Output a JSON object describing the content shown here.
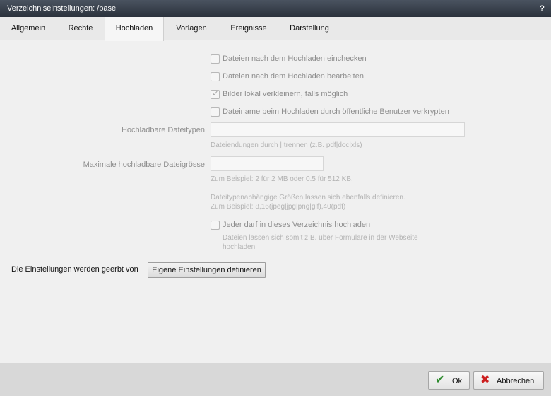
{
  "window": {
    "title": "Verzeichniseinstellungen: /base",
    "help": "?"
  },
  "tabs": [
    "Allgemein",
    "Rechte",
    "Hochladen",
    "Vorlagen",
    "Ereignisse",
    "Darstellung"
  ],
  "active_tab": "Hochladen",
  "options": {
    "checkin": {
      "label": "Dateien nach dem Hochladen einchecken",
      "checked": false
    },
    "edit": {
      "label": "Dateien nach dem Hochladen bearbeiten",
      "checked": false
    },
    "resize": {
      "label": "Bilder lokal verkleinern, falls möglich",
      "checked": true
    },
    "encrypt": {
      "label": "Dateiname beim Hochladen durch öffentliche Benutzer verkrypten",
      "checked": false
    }
  },
  "filetypes": {
    "label": "Hochladbare Dateitypen",
    "value": "",
    "hint": "Dateiendungen durch | trennen (z.B. pdf|doc|xls)"
  },
  "maxsize": {
    "label": "Maximale hochladbare Dateigrösse",
    "value": "",
    "hint1": "Zum Beispiel: 2 für 2 MB oder 0.5 für 512 KB.",
    "hint2": "Dateitypenabhängige Größen lassen sich ebenfalls definieren.",
    "hint3": "Zum Beispiel: 8,16(jpeg|jpg|png|gif),40(pdf)"
  },
  "public_upload": {
    "label": "Jeder darf in dieses Verzeichnis hochladen",
    "checked": false,
    "hint1": "Dateien lassen sich somit z.B. über Formulare in der Webseite",
    "hint2": "hochladen."
  },
  "inherit": {
    "text": "Die Einstellungen werden geerbt von",
    "button": "Eigene Einstellungen definieren"
  },
  "footer": {
    "ok": "Ok",
    "cancel": "Abbrechen"
  },
  "colors": {
    "ok_icon": "#2e8b2e",
    "cancel_icon": "#cc1f1f",
    "titlebar": "#2f3640"
  }
}
